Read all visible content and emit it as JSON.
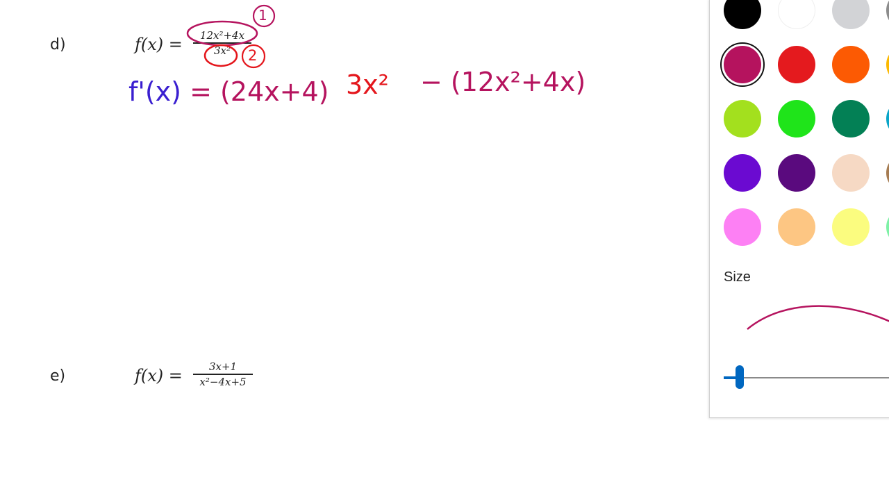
{
  "problems": [
    {
      "label": "d)",
      "lhs": "f(x) =",
      "numerator": "12x²+4x",
      "denominator": "3x²"
    },
    {
      "label": "e)",
      "lhs": "f(x) =",
      "numerator": "3x+1",
      "denominator": "x²−4x+5"
    }
  ],
  "annotations": {
    "circle_1": "1",
    "circle_2": "2",
    "derivative_lhs": "f'(x) = (24x+4)",
    "derivative_red": "3x²",
    "derivative_rest": "− (12x²+4x)"
  },
  "colors": {
    "ink_blue": "#3a1fd0",
    "ink_magenta": "#b5135e",
    "ink_red": "#e4161c"
  },
  "pen_panel": {
    "palette": [
      {
        "name": "black",
        "color": "#000000"
      },
      {
        "name": "white",
        "color": "#ffffff"
      },
      {
        "name": "light-gray",
        "color": "#d2d3d6"
      },
      {
        "name": "gray",
        "color": "#8c8c8c"
      },
      {
        "name": "magenta",
        "color": "#b5135e",
        "selected": true
      },
      {
        "name": "red",
        "color": "#e41a1e"
      },
      {
        "name": "orange",
        "color": "#fc5a03"
      },
      {
        "name": "amber",
        "color": "#fcb900"
      },
      {
        "name": "lime",
        "color": "#a3e01e"
      },
      {
        "name": "green",
        "color": "#1fe41a"
      },
      {
        "name": "teal-green",
        "color": "#038055"
      },
      {
        "name": "cyan",
        "color": "#0aa5c8"
      },
      {
        "name": "purple",
        "color": "#6b0ad1"
      },
      {
        "name": "dark-purple",
        "color": "#5a0a7e"
      },
      {
        "name": "peach",
        "color": "#f6d9c4"
      },
      {
        "name": "tan",
        "color": "#a67c52"
      },
      {
        "name": "pink",
        "color": "#fd80f4"
      },
      {
        "name": "light-orange",
        "color": "#fdc683"
      },
      {
        "name": "light-yellow",
        "color": "#fbfc7f"
      },
      {
        "name": "mint",
        "color": "#7ef1a6"
      }
    ],
    "size_label": "Size",
    "size_value": 0.08
  }
}
